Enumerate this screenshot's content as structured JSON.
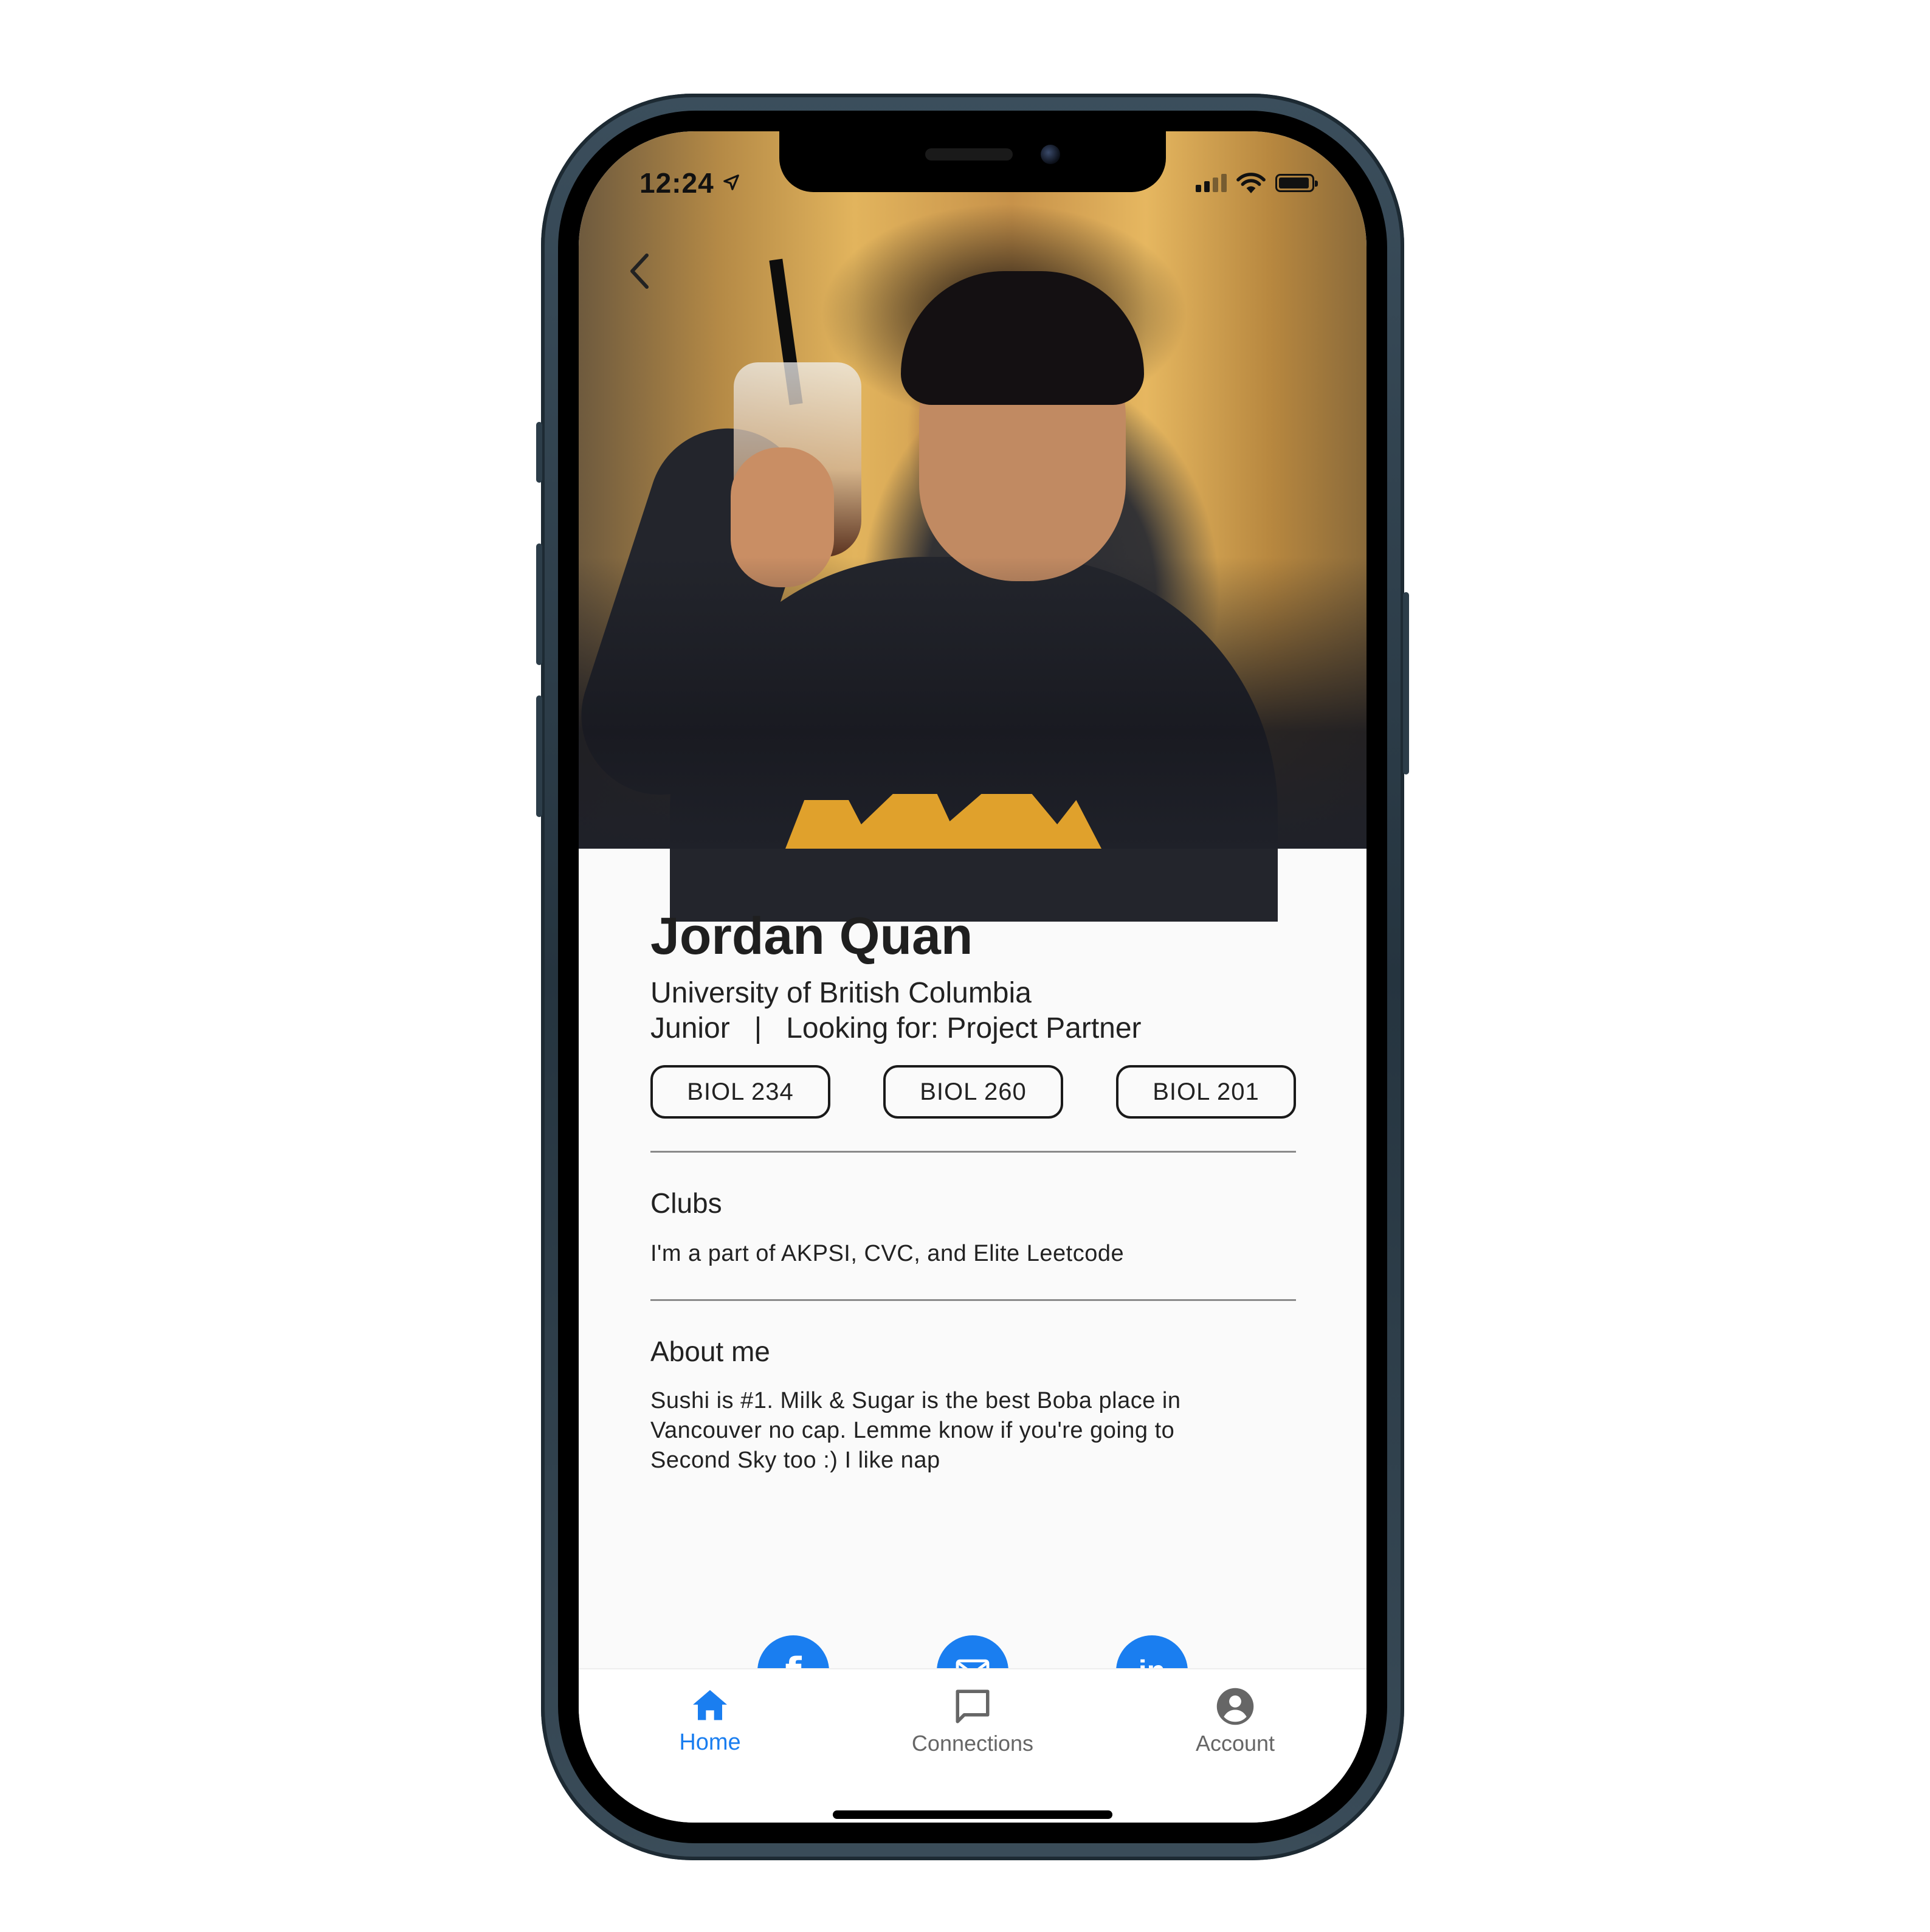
{
  "status_bar": {
    "time": "12:24"
  },
  "profile": {
    "name": "Jordan Quan",
    "university": "University of British Columbia",
    "year": "Junior",
    "separator": "|",
    "looking_for": "Looking for: Project Partner",
    "courses": [
      "BIOL 234",
      "BIOL 260",
      "BIOL 201"
    ]
  },
  "clubs": {
    "title": "Clubs",
    "text": "I'm a part of AKPSI, CVC, and Elite Leetcode"
  },
  "about": {
    "title": "About me",
    "text": "Sushi is #1.  Milk & Sugar is the best Boba place in Vancouver no cap.  Lemme know if you're going to Second Sky too :) I like nap"
  },
  "socials": {
    "facebook_glyph": "f",
    "linkedin_glyph": "in"
  },
  "tabs": [
    {
      "label": "Home",
      "icon": "home-icon",
      "active": true
    },
    {
      "label": "Connections",
      "icon": "chat-bubble-icon",
      "active": false
    },
    {
      "label": "Account",
      "icon": "account-circle-icon",
      "active": false
    }
  ],
  "colors": {
    "accent": "#1a7ef0",
    "tab_inactive": "#666666",
    "text": "#222222"
  }
}
